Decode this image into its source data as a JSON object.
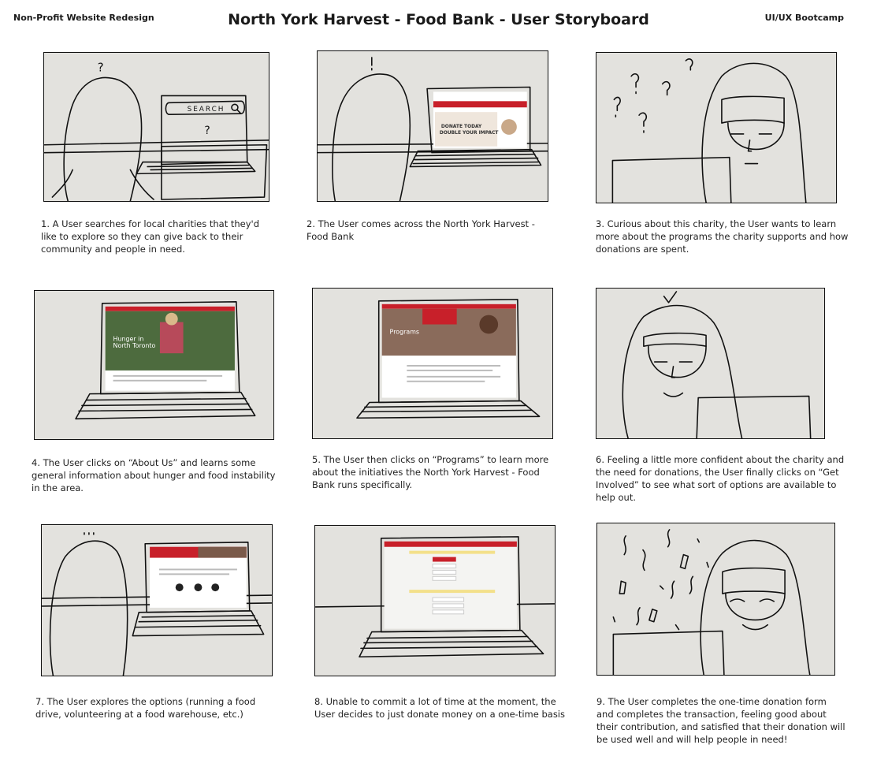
{
  "header": {
    "left": "Non-Profit Website Redesign",
    "title": "North York Harvest - Food Bank - User Storyboard",
    "right": "UI/UX Bootcamp"
  },
  "panels": [
    {
      "caption": "1. A User searches for local charities that they'd like to explore so they can give back to their community and people in need.",
      "search_label": "SEARCH",
      "question_mark": "?"
    },
    {
      "caption": "2. The User comes across the North York Harvest - Food Bank",
      "screen_line1": "DONATE TODAY",
      "screen_line2": "DOUBLE YOUR IMPACT"
    },
    {
      "caption": "3. Curious about this charity, the User wants to learn more about the programs the charity supports and how donations are spent."
    },
    {
      "caption": "4. The User clicks on “About Us” and learns some general information about hunger and food instability in the area.",
      "screen_line1": "Hunger in",
      "screen_line2": "North Toronto"
    },
    {
      "caption": "5. The User then clicks on “Programs” to learn more about the initiatives the North York Harvest - Food Bank runs specifically.",
      "screen_label": "Programs"
    },
    {
      "caption": "6. Feeling a little more confident about the charity and the need for donations, the User finally clicks on “Get Involved” to see what sort of options are available to help out."
    },
    {
      "caption": "7. The User explores the options (running a food drive, volunteering at a food warehouse, etc.)"
    },
    {
      "caption": "8. Unable to commit a lot of time at the moment, the User decides to just donate money on a one-time basis"
    },
    {
      "caption": "9. The User completes the one-time donation form and completes the transaction, feeling good about their contribution, and satisfied that their donation will be used well and will help people in need!"
    }
  ],
  "colors": {
    "paper": "#e3e2de",
    "ink": "#111111",
    "brand_red": "#c8202a",
    "highlight_yellow": "#f3e08a"
  }
}
